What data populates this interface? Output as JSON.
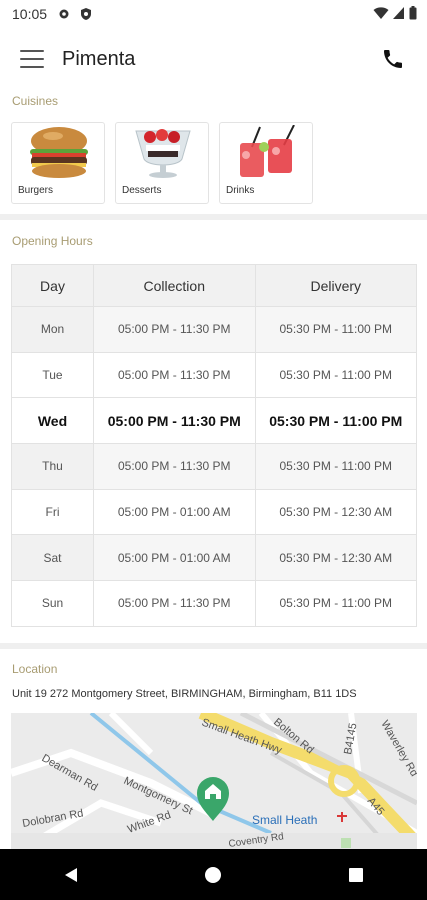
{
  "status_bar": {
    "time": "10:05"
  },
  "app_bar": {
    "title": "Pimenta"
  },
  "cuisines": {
    "label": "Cuisines",
    "items": [
      {
        "name": "Burgers"
      },
      {
        "name": "Desserts"
      },
      {
        "name": "Drinks"
      }
    ]
  },
  "opening_hours": {
    "label": "Opening Hours",
    "headers": [
      "Day",
      "Collection",
      "Delivery"
    ],
    "rows": [
      {
        "day": "Mon",
        "collection": "05:00 PM - 11:30 PM",
        "delivery": "05:30 PM - 11:00 PM"
      },
      {
        "day": "Tue",
        "collection": "05:00 PM - 11:30 PM",
        "delivery": "05:30 PM - 11:00 PM"
      },
      {
        "day": "Wed",
        "collection": "05:00 PM - 11:30 PM",
        "delivery": "05:30 PM - 11:00 PM"
      },
      {
        "day": "Thu",
        "collection": "05:00 PM - 11:30 PM",
        "delivery": "05:30 PM - 11:00 PM"
      },
      {
        "day": "Fri",
        "collection": "05:00 PM - 01:00 AM",
        "delivery": "05:30 PM - 12:30 AM"
      },
      {
        "day": "Sat",
        "collection": "05:00 PM - 01:00 AM",
        "delivery": "05:30 PM - 12:30 AM"
      },
      {
        "day": "Sun",
        "collection": "05:00 PM - 11:30 PM",
        "delivery": "05:30 PM - 11:00 PM"
      }
    ]
  },
  "location": {
    "label": "Location",
    "address": "Unit 19 272 Montgomery Street, BIRMINGHAM, Birmingham, B11 1DS",
    "map_labels": {
      "road_1": "Small Heath Hwy",
      "road_2": "Bolton Rd",
      "road_3": "B4145",
      "road_4": "Waverley Rd",
      "road_5": "Dearman Rd",
      "road_6": "Montgomery St",
      "road_7": "White Rd",
      "road_8": "Dolobran Rd",
      "road_9": "A45",
      "road_10": "Coventry Rd",
      "place": "Small Heath"
    }
  },
  "colors": {
    "accent": "#a89c72",
    "map_pin": "#3aa66a",
    "highway": "#f4dc6c"
  }
}
